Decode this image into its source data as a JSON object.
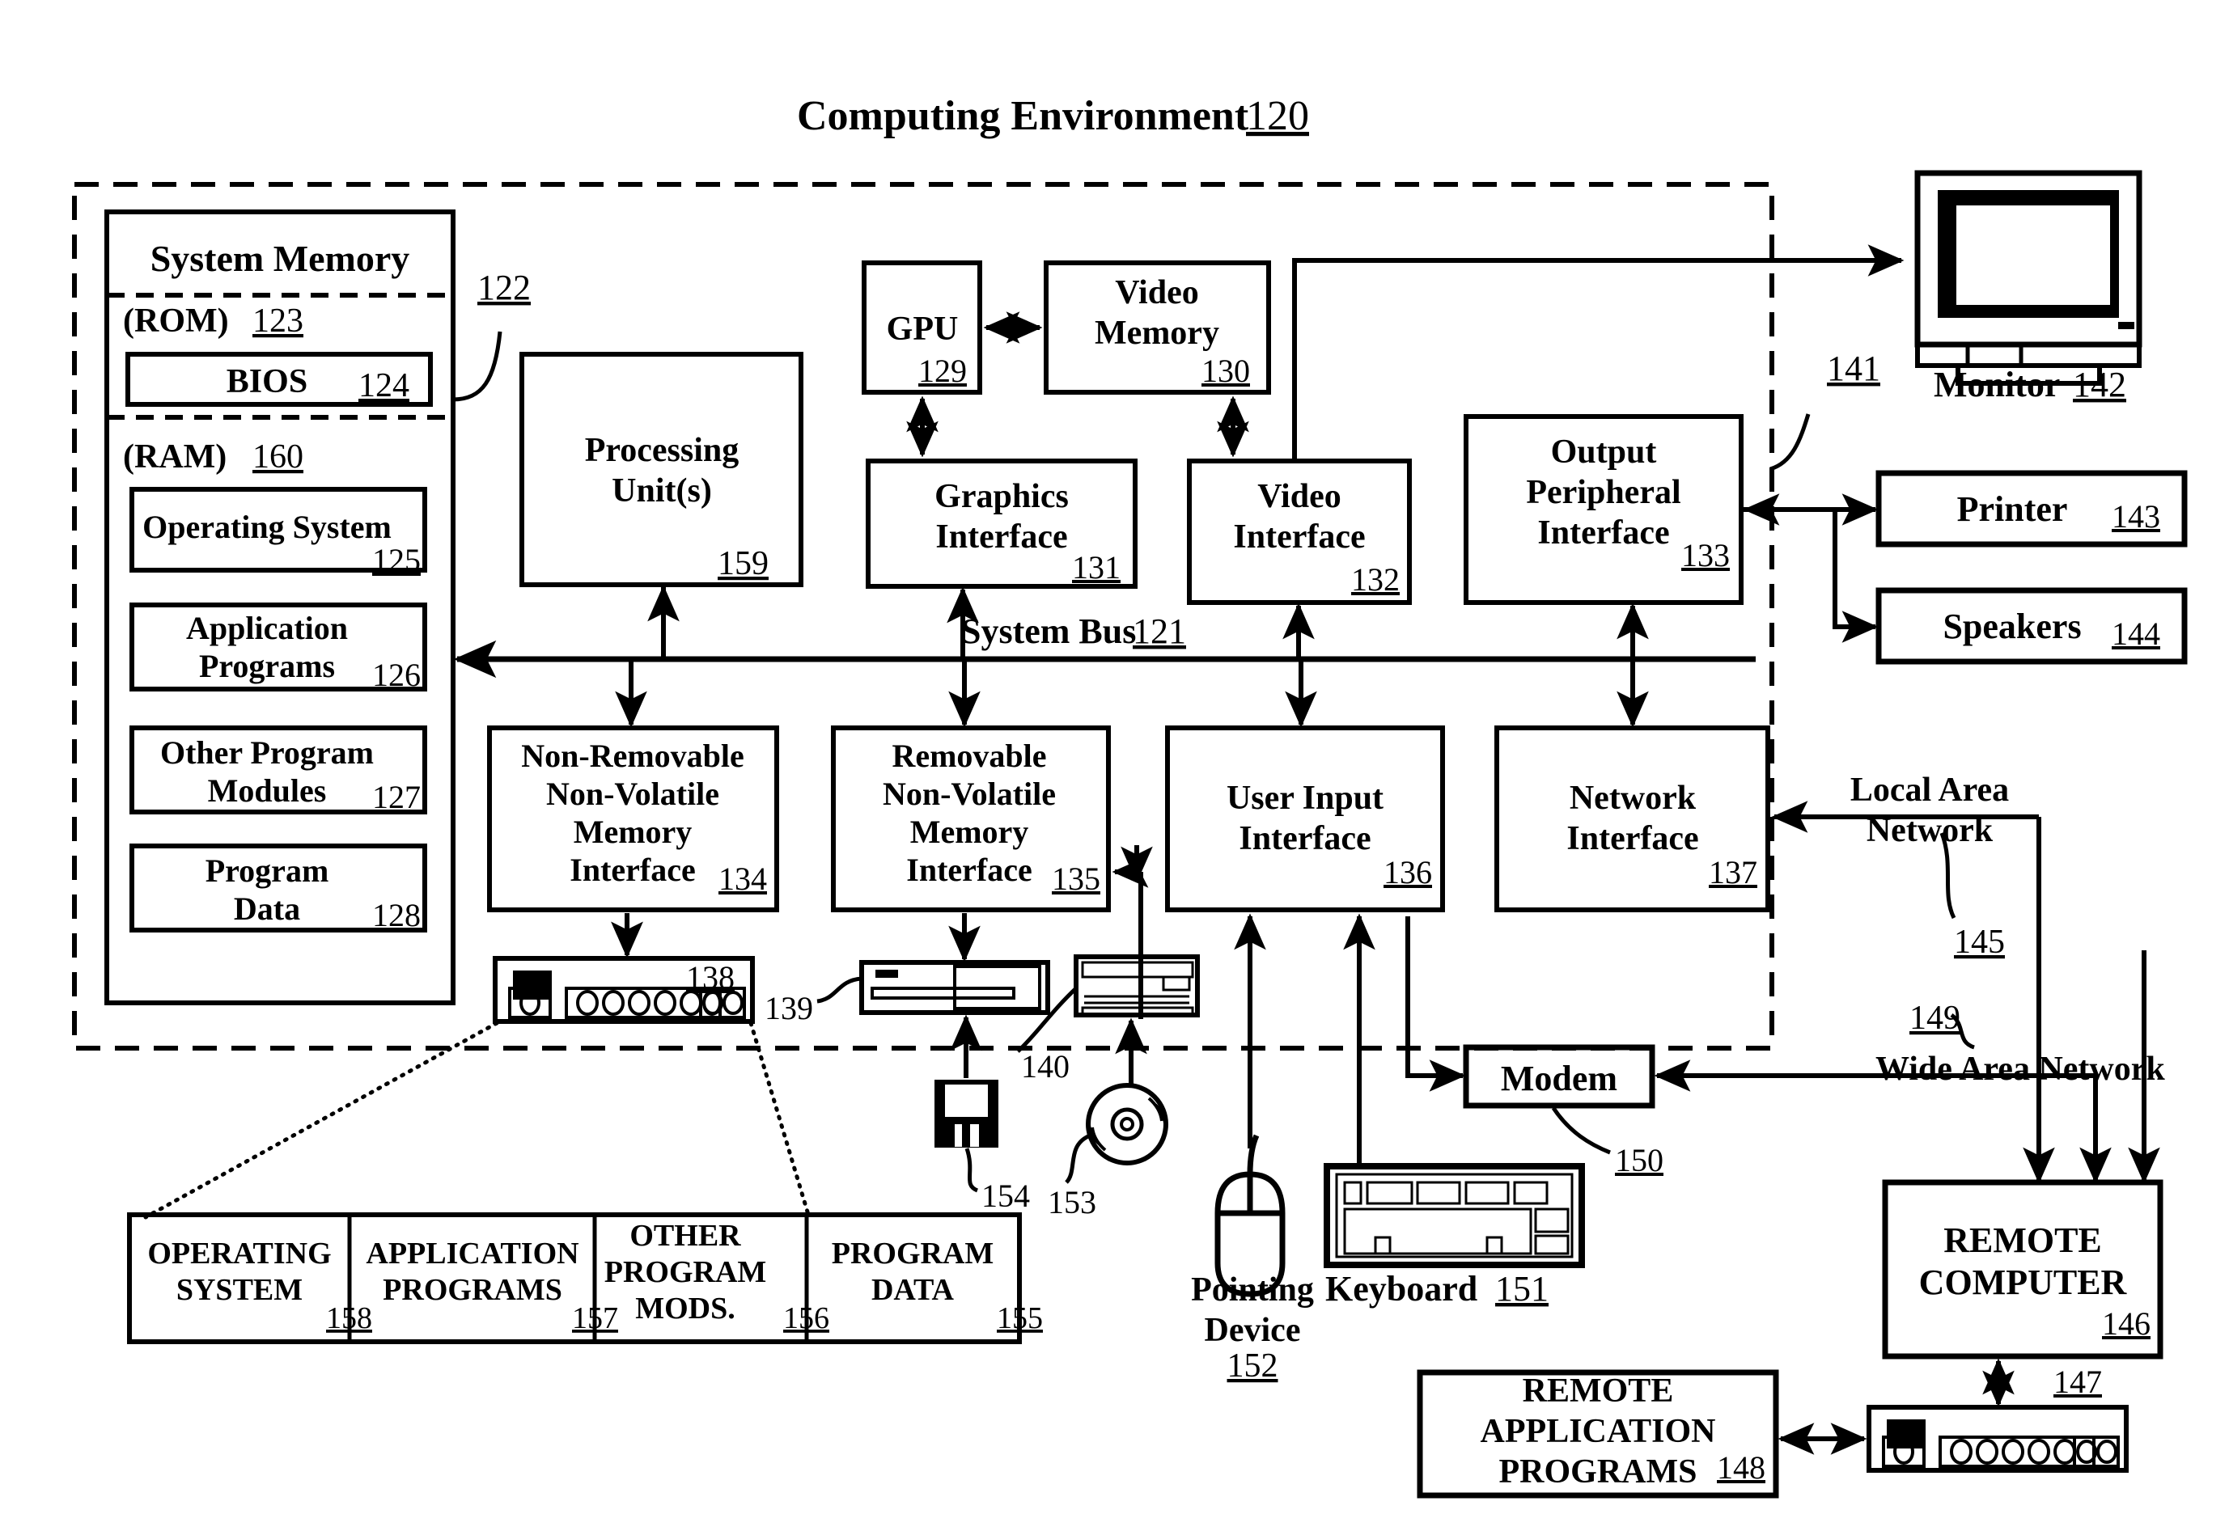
{
  "figure": {
    "title": "Computing Environment",
    "title_ref": "120"
  },
  "system_memory": {
    "heading": "System Memory",
    "ref_leader": "122",
    "rom_label": "(ROM)",
    "rom_ref": "123",
    "bios_label": "BIOS",
    "bios_ref": "124",
    "ram_label": "(RAM)",
    "ram_ref": "160",
    "items": [
      {
        "label": "Operating System",
        "ref": "125"
      },
      {
        "label": "Application\nPrograms",
        "ref": "126"
      },
      {
        "label": "Other Program\nModules",
        "ref": "127"
      },
      {
        "label": "Program\nData",
        "ref": "128"
      }
    ]
  },
  "bus": {
    "label": "System Bus",
    "ref": "121"
  },
  "blocks": {
    "processing_unit": {
      "label": "Processing\nUnit(s)",
      "ref": "159"
    },
    "gpu": {
      "label": "GPU",
      "ref": "129"
    },
    "video_memory": {
      "label": "Video\nMemory",
      "ref": "130"
    },
    "graphics_interface": {
      "label": "Graphics\nInterface",
      "ref": "131"
    },
    "video_interface": {
      "label": "Video\nInterface",
      "ref": "132"
    },
    "output_peripheral_interface": {
      "label": "Output\nPeripheral\nInterface",
      "ref": "133"
    },
    "non_removable_interface": {
      "label": "Non-Removable\nNon-Volatile\nMemory\nInterface",
      "ref": "134"
    },
    "removable_interface": {
      "label": "Removable\nNon-Volatile\nMemory\nInterface",
      "ref": "135"
    },
    "user_input_interface": {
      "label": "User Input\nInterface",
      "ref": "136"
    },
    "network_interface": {
      "label": "Network\nInterface",
      "ref": "137"
    },
    "modem": {
      "label": "Modem",
      "ref": "150"
    },
    "remote_computer": {
      "label": "REMOTE\nCOMPUTER",
      "ref": "146"
    },
    "remote_application_programs": {
      "label": "REMOTE\nAPPLICATION\nPROGRAMS",
      "ref": "148"
    }
  },
  "peripherals": {
    "monitor": {
      "label": "Monitor",
      "ref": "142",
      "leader_ref": "141"
    },
    "printer": {
      "label": "Printer",
      "ref": "143"
    },
    "speakers": {
      "label": "Speakers",
      "ref": "144"
    },
    "pointing_device": {
      "label": "Pointing\nDevice",
      "ref": "152"
    },
    "keyboard": {
      "label": "Keyboard",
      "ref": "151"
    }
  },
  "storage": {
    "hard_drive_ref": "138",
    "floppy_drive_ref": "139",
    "optical_drive_ref": "140",
    "floppy_disk_ref": "154",
    "optical_disc_ref": "153",
    "remote_drive_ref": "147"
  },
  "networks": {
    "lan_label": "Local Area\nNetwork",
    "lan_ref": "145",
    "wan_label": "Wide Area Network",
    "wan_ref": "149"
  },
  "disk_contents": [
    {
      "label": "OPERATING\nSYSTEM",
      "ref": "158"
    },
    {
      "label": "APPLICATION\nPROGRAMS",
      "ref": "157"
    },
    {
      "label": "OTHER\nPROGRAM\nMODS.",
      "ref": "156"
    },
    {
      "label": "PROGRAM\nDATA",
      "ref": "155"
    }
  ],
  "colors": {
    "ink": "#000000",
    "paper": "#ffffff"
  }
}
